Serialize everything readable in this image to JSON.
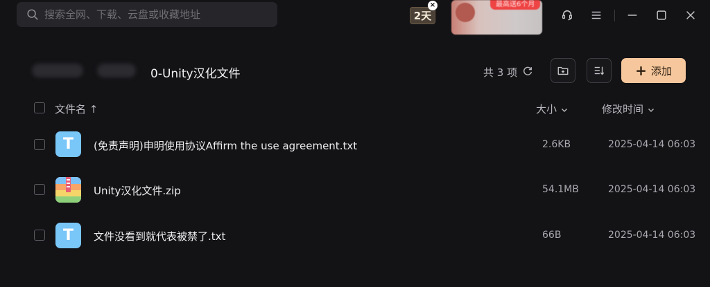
{
  "search": {
    "placeholder": "搜索全网、下载、云盘或收藏地址"
  },
  "badge": {
    "days": "2天",
    "close": "×"
  },
  "promo": {
    "ribbon": "最高送6个月"
  },
  "breadcrumb": {
    "current": "0-Unity汉化文件"
  },
  "toolbar": {
    "count": "共 3 项",
    "add_label": "添加"
  },
  "columns": {
    "name": "文件名",
    "size": "大小",
    "modified": "修改时间"
  },
  "files": [
    {
      "name": "(免责声明)申明使用协议Affirm the use agreement.txt",
      "size": "2.6KB",
      "modified": "2025-04-14 06:03",
      "type": "txt",
      "icon_letter": "T"
    },
    {
      "name": "Unity汉化文件.zip",
      "size": "54.1MB",
      "modified": "2025-04-14 06:03",
      "type": "zip"
    },
    {
      "name": "文件没看到就代表被禁了.txt",
      "size": "66B",
      "modified": "2025-04-14 06:03",
      "type": "txt",
      "icon_letter": "T"
    }
  ],
  "colors": {
    "accent": "#f6c79c",
    "txt_icon": "#79c6f8",
    "background": "#131316"
  }
}
